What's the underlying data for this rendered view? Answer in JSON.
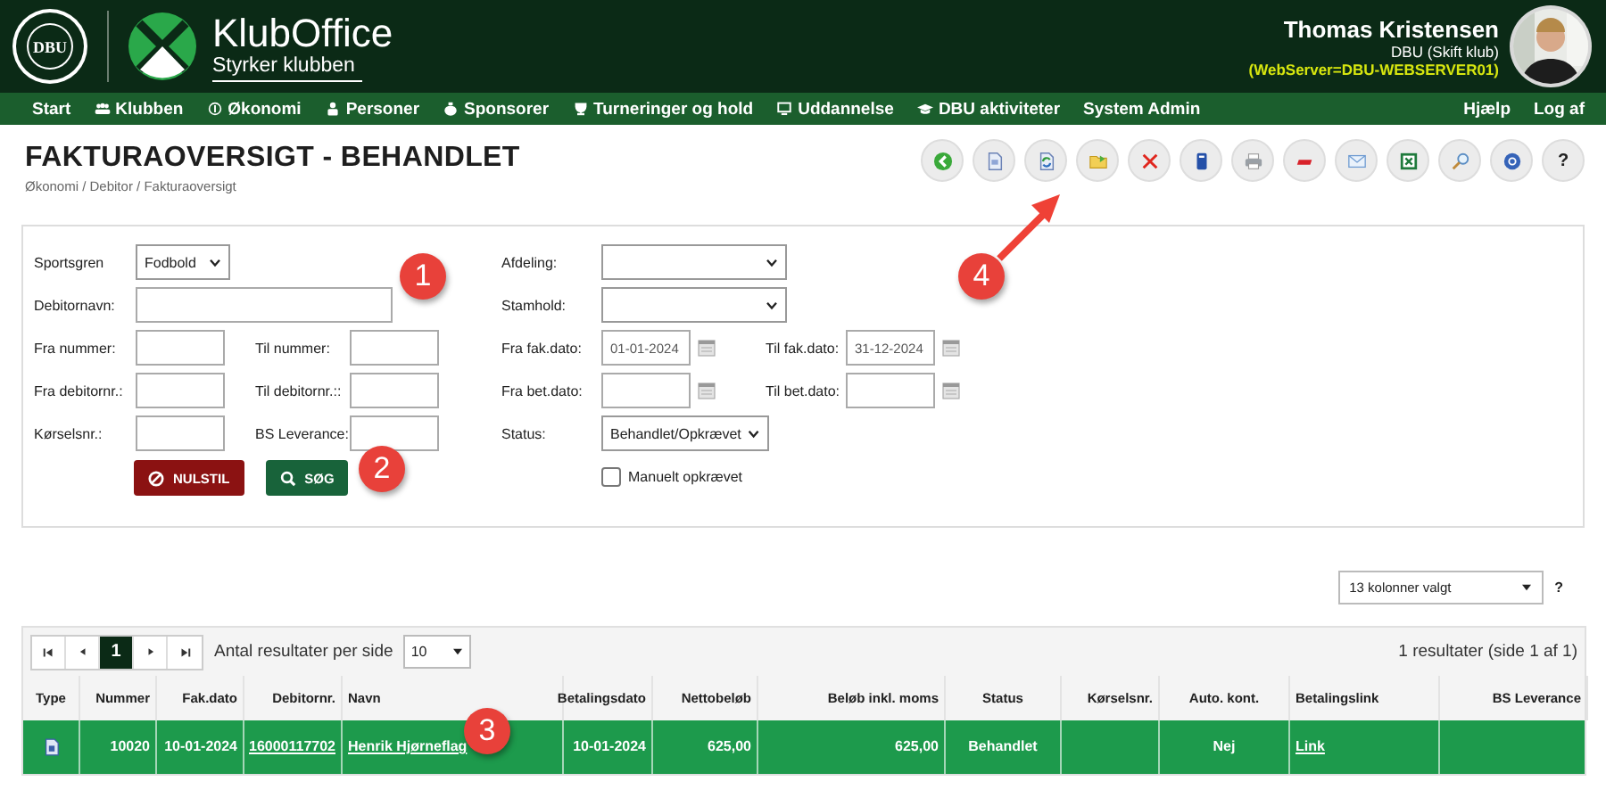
{
  "header": {
    "crest_text": "DBU",
    "app_name": "KlubOffice",
    "tagline": "Styrker klubben",
    "user_name": "Thomas Kristensen",
    "club": "DBU (Skift klub)",
    "server": "(WebServer=DBU-WEBSERVER01)"
  },
  "nav": {
    "items": [
      {
        "label": "Start",
        "kind": "plain"
      },
      {
        "label": "Klubben",
        "kind": "people"
      },
      {
        "label": "Økonomi",
        "kind": "coin"
      },
      {
        "label": "Personer",
        "kind": "person"
      },
      {
        "label": "Sponsorer",
        "kind": "moneybag"
      },
      {
        "label": "Turneringer og hold",
        "kind": "trophy"
      },
      {
        "label": "Uddannelse",
        "kind": "screen"
      },
      {
        "label": "DBU aktiviteter",
        "kind": "cap"
      },
      {
        "label": "System Admin",
        "kind": "plain"
      }
    ],
    "right_items": [
      {
        "label": "Hjælp"
      },
      {
        "label": "Log af"
      }
    ]
  },
  "page": {
    "title": "FAKTURAOVERSIGT - BEHANDLET",
    "breadcrumb": "Økonomi / Debitor / Fakturaoversigt"
  },
  "toolbar": [
    {
      "kind": "back"
    },
    {
      "kind": "document"
    },
    {
      "kind": "refresh"
    },
    {
      "kind": "folder"
    },
    {
      "kind": "delete"
    },
    {
      "kind": "book"
    },
    {
      "kind": "print"
    },
    {
      "kind": "red-bar"
    },
    {
      "kind": "mail"
    },
    {
      "kind": "excel"
    },
    {
      "kind": "search"
    },
    {
      "kind": "help"
    },
    {
      "kind": "text",
      "label": "?"
    }
  ],
  "filters": {
    "left_rows": [
      [
        {
          "label": "Sportsgren",
          "kind": "select",
          "value": "Fodbold"
        }
      ],
      [
        {
          "label": "Debitornavn:",
          "kind": "text"
        }
      ],
      [
        {
          "label": "Fra nummer:",
          "kind": "text"
        },
        {
          "label": "Til nummer:",
          "kind": "text"
        }
      ],
      [
        {
          "label": "Fra debitornr.:",
          "kind": "text"
        },
        {
          "label": "Til debitornr.::",
          "kind": "text"
        }
      ],
      [
        {
          "label": "Kørselsnr.:",
          "kind": "text"
        },
        {
          "label": "BS Leverance:",
          "kind": "text"
        }
      ]
    ],
    "right_rows": [
      [
        {
          "label": "Afdeling:",
          "kind": "select"
        }
      ],
      [
        {
          "label": "Stamhold:",
          "kind": "select"
        }
      ],
      [
        {
          "label": "Fra fak.dato:",
          "kind": "date",
          "value": "01-01-2024"
        },
        {
          "label": "Til fak.dato:",
          "kind": "date",
          "value": "31-12-2024"
        }
      ],
      [
        {
          "label": "Fra bet.dato:",
          "kind": "date"
        },
        {
          "label": "Til bet.dato:",
          "kind": "date"
        }
      ],
      [
        {
          "label": "Status:",
          "kind": "select",
          "value": "Behandlet/Opkrævet"
        }
      ],
      [
        {
          "label": "Manuelt opkrævet",
          "kind": "checkbox",
          "checked": false
        }
      ]
    ],
    "buttons": [
      {
        "label": "NULSTIL",
        "kind": "reset"
      },
      {
        "label": "SØG",
        "kind": "search"
      }
    ]
  },
  "column_chooser": {
    "value": "13 kolonner valgt",
    "help": "?"
  },
  "grid": {
    "pages": [
      {
        "label": "1",
        "selected": true
      }
    ],
    "per_page_label": "Antal resultater per side",
    "per_page": "10",
    "result_count": "1 resultater (side 1 af 1)",
    "columns": [
      "Type",
      "Nummer",
      "Fak.dato",
      "Debitornr.",
      "Navn",
      "Betalingsdato",
      "Nettobeløb",
      "Beløb inkl. moms",
      "Status",
      "Kørselsnr.",
      "Auto. kont.",
      "Betalingslink",
      "BS Leverance"
    ],
    "rows": [
      {
        "selected": true,
        "cells": [
          {
            "kind": "icon"
          },
          {
            "kind": "text",
            "text": "10020"
          },
          {
            "kind": "text",
            "text": "10-01-2024"
          },
          {
            "kind": "link",
            "text": "16000117702"
          },
          {
            "kind": "link",
            "text": "Henrik Hjørneflag"
          },
          {
            "kind": "text",
            "text": "10-01-2024"
          },
          {
            "kind": "text",
            "text": "625,00"
          },
          {
            "kind": "text",
            "text": "625,00"
          },
          {
            "kind": "text",
            "text": "Behandlet"
          },
          {
            "kind": "empty"
          },
          {
            "kind": "text",
            "text": "Nej"
          },
          {
            "kind": "link",
            "text": "Link"
          },
          {
            "kind": "empty"
          }
        ]
      }
    ]
  },
  "annotations": [
    {
      "label": "1",
      "arrow": false
    },
    {
      "label": "2",
      "arrow": false
    },
    {
      "label": "3",
      "arrow": false
    },
    {
      "label": "4",
      "arrow": true
    }
  ]
}
